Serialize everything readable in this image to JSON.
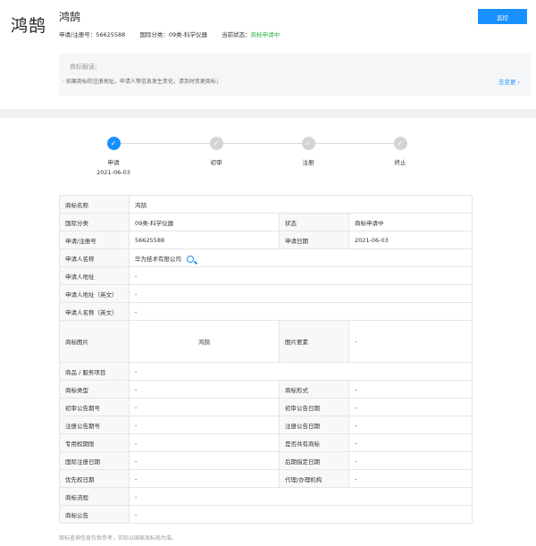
{
  "header": {
    "logo_text": "鸿鹄",
    "title": "鸿鹄",
    "reg_no_label": "申请/注册号：",
    "reg_no": "56625588",
    "class_label": "国际分类：",
    "class_value": "09类-科学仪器",
    "status_label": "当前状态：",
    "status_value": "商标申请中",
    "monitor_button": "监控"
  },
  "notice": {
    "title": "商标解读：",
    "text": "· 如果商标的注册地址，申请人等信息发生变化，请及时变更商标；",
    "link": "去变更 ›"
  },
  "steps": [
    {
      "label": "申请",
      "date": "2021-06-03",
      "state": "active"
    },
    {
      "label": "初审",
      "date": "",
      "state": "inactive"
    },
    {
      "label": "注册",
      "date": "",
      "state": "inactive"
    },
    {
      "label": "终止",
      "date": "",
      "state": "inactive"
    }
  ],
  "table": {
    "name_k": "商标名称",
    "name_v": "鸿鹄",
    "class_k": "国际分类",
    "class_v": "09类-科学仪器",
    "status_k": "状态",
    "status_v": "商标申请中",
    "regno_k": "申请/注册号",
    "regno_v": "56625588",
    "appdate_k": "申请日期",
    "appdate_v": "2021-06-03",
    "applicant_k": "申请人名称",
    "applicant_v": "华为技术有限公司",
    "addr_k": "申请人地址",
    "addr_v": "-",
    "addr_en_k": "申请人地址（英文）",
    "addr_en_v": "-",
    "name_en_k": "申请人名称（英文）",
    "name_en_v": "-",
    "image_k": "商标图片",
    "image_v": "鸿鹄",
    "elements_k": "图片要素",
    "elements_v": "-",
    "goods_k": "商品 / 服务项目",
    "goods_v": "-",
    "type_k": "商标类型",
    "type_v": "-",
    "form_k": "商标形式",
    "form_v": "-",
    "prelim_no_k": "初审公告期号",
    "prelim_no_v": "-",
    "prelim_date_k": "初审公告日期",
    "prelim_date_v": "-",
    "reg_no_k": "注册公告期号",
    "reg_no_v": "-",
    "reg_date_k": "注册公告日期",
    "reg_date_v": "-",
    "exclusive_k": "专用权期限",
    "exclusive_v": "-",
    "shared_k": "是否共有商标",
    "shared_v": "-",
    "intl_date_k": "国际注册日期",
    "intl_date_v": "-",
    "later_date_k": "后期指定日期",
    "later_date_v": "-",
    "priority_k": "优先权日期",
    "priority_v": "-",
    "agent_k": "代理/办理机构",
    "agent_v": "-",
    "process_k": "商标流程",
    "process_v": "-",
    "announce_k": "商标公告",
    "announce_v": "-"
  },
  "footnote": "商标查询信息仅供参考，实际以国家商标局为准。",
  "colors": {
    "accent": "#1890ff",
    "status_green": "#27b148"
  }
}
